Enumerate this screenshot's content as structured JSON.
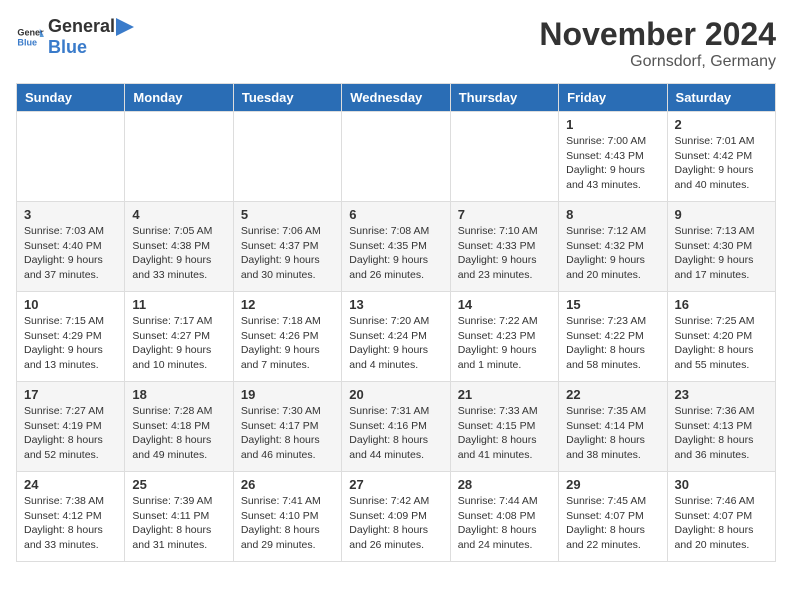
{
  "header": {
    "logo_general": "General",
    "logo_blue": "Blue",
    "month": "November 2024",
    "location": "Gornsdorf, Germany"
  },
  "weekdays": [
    "Sunday",
    "Monday",
    "Tuesday",
    "Wednesday",
    "Thursday",
    "Friday",
    "Saturday"
  ],
  "weeks": [
    [
      {
        "day": "",
        "info": ""
      },
      {
        "day": "",
        "info": ""
      },
      {
        "day": "",
        "info": ""
      },
      {
        "day": "",
        "info": ""
      },
      {
        "day": "",
        "info": ""
      },
      {
        "day": "1",
        "info": "Sunrise: 7:00 AM\nSunset: 4:43 PM\nDaylight: 9 hours\nand 43 minutes."
      },
      {
        "day": "2",
        "info": "Sunrise: 7:01 AM\nSunset: 4:42 PM\nDaylight: 9 hours\nand 40 minutes."
      }
    ],
    [
      {
        "day": "3",
        "info": "Sunrise: 7:03 AM\nSunset: 4:40 PM\nDaylight: 9 hours\nand 37 minutes."
      },
      {
        "day": "4",
        "info": "Sunrise: 7:05 AM\nSunset: 4:38 PM\nDaylight: 9 hours\nand 33 minutes."
      },
      {
        "day": "5",
        "info": "Sunrise: 7:06 AM\nSunset: 4:37 PM\nDaylight: 9 hours\nand 30 minutes."
      },
      {
        "day": "6",
        "info": "Sunrise: 7:08 AM\nSunset: 4:35 PM\nDaylight: 9 hours\nand 26 minutes."
      },
      {
        "day": "7",
        "info": "Sunrise: 7:10 AM\nSunset: 4:33 PM\nDaylight: 9 hours\nand 23 minutes."
      },
      {
        "day": "8",
        "info": "Sunrise: 7:12 AM\nSunset: 4:32 PM\nDaylight: 9 hours\nand 20 minutes."
      },
      {
        "day": "9",
        "info": "Sunrise: 7:13 AM\nSunset: 4:30 PM\nDaylight: 9 hours\nand 17 minutes."
      }
    ],
    [
      {
        "day": "10",
        "info": "Sunrise: 7:15 AM\nSunset: 4:29 PM\nDaylight: 9 hours\nand 13 minutes."
      },
      {
        "day": "11",
        "info": "Sunrise: 7:17 AM\nSunset: 4:27 PM\nDaylight: 9 hours\nand 10 minutes."
      },
      {
        "day": "12",
        "info": "Sunrise: 7:18 AM\nSunset: 4:26 PM\nDaylight: 9 hours\nand 7 minutes."
      },
      {
        "day": "13",
        "info": "Sunrise: 7:20 AM\nSunset: 4:24 PM\nDaylight: 9 hours\nand 4 minutes."
      },
      {
        "day": "14",
        "info": "Sunrise: 7:22 AM\nSunset: 4:23 PM\nDaylight: 9 hours\nand 1 minute."
      },
      {
        "day": "15",
        "info": "Sunrise: 7:23 AM\nSunset: 4:22 PM\nDaylight: 8 hours\nand 58 minutes."
      },
      {
        "day": "16",
        "info": "Sunrise: 7:25 AM\nSunset: 4:20 PM\nDaylight: 8 hours\nand 55 minutes."
      }
    ],
    [
      {
        "day": "17",
        "info": "Sunrise: 7:27 AM\nSunset: 4:19 PM\nDaylight: 8 hours\nand 52 minutes."
      },
      {
        "day": "18",
        "info": "Sunrise: 7:28 AM\nSunset: 4:18 PM\nDaylight: 8 hours\nand 49 minutes."
      },
      {
        "day": "19",
        "info": "Sunrise: 7:30 AM\nSunset: 4:17 PM\nDaylight: 8 hours\nand 46 minutes."
      },
      {
        "day": "20",
        "info": "Sunrise: 7:31 AM\nSunset: 4:16 PM\nDaylight: 8 hours\nand 44 minutes."
      },
      {
        "day": "21",
        "info": "Sunrise: 7:33 AM\nSunset: 4:15 PM\nDaylight: 8 hours\nand 41 minutes."
      },
      {
        "day": "22",
        "info": "Sunrise: 7:35 AM\nSunset: 4:14 PM\nDaylight: 8 hours\nand 38 minutes."
      },
      {
        "day": "23",
        "info": "Sunrise: 7:36 AM\nSunset: 4:13 PM\nDaylight: 8 hours\nand 36 minutes."
      }
    ],
    [
      {
        "day": "24",
        "info": "Sunrise: 7:38 AM\nSunset: 4:12 PM\nDaylight: 8 hours\nand 33 minutes."
      },
      {
        "day": "25",
        "info": "Sunrise: 7:39 AM\nSunset: 4:11 PM\nDaylight: 8 hours\nand 31 minutes."
      },
      {
        "day": "26",
        "info": "Sunrise: 7:41 AM\nSunset: 4:10 PM\nDaylight: 8 hours\nand 29 minutes."
      },
      {
        "day": "27",
        "info": "Sunrise: 7:42 AM\nSunset: 4:09 PM\nDaylight: 8 hours\nand 26 minutes."
      },
      {
        "day": "28",
        "info": "Sunrise: 7:44 AM\nSunset: 4:08 PM\nDaylight: 8 hours\nand 24 minutes."
      },
      {
        "day": "29",
        "info": "Sunrise: 7:45 AM\nSunset: 4:07 PM\nDaylight: 8 hours\nand 22 minutes."
      },
      {
        "day": "30",
        "info": "Sunrise: 7:46 AM\nSunset: 4:07 PM\nDaylight: 8 hours\nand 20 minutes."
      }
    ]
  ]
}
